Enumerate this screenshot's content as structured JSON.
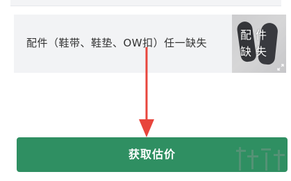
{
  "option_card": {
    "label": "配件（鞋带、鞋垫、OW扣）任一缺失",
    "thumbnail": {
      "overlay_text": "配件缺失",
      "icon": "expand-icon"
    }
  },
  "annotation": {
    "icon": "arrow-down-icon",
    "color": "#e8453c"
  },
  "action": {
    "estimate_label": "获取估价",
    "color": "#2f8f62"
  }
}
